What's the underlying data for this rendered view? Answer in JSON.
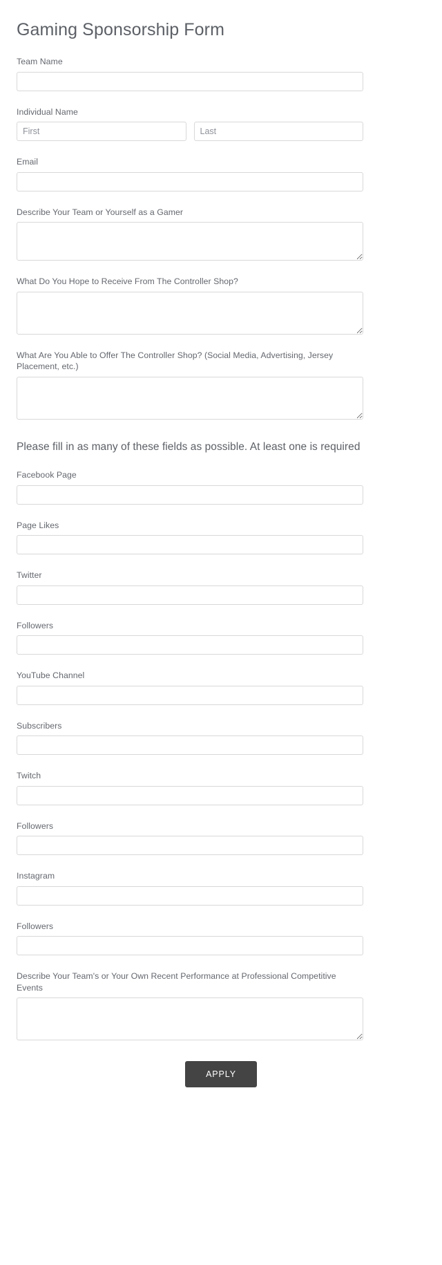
{
  "form": {
    "title": "Gaming Sponsorship Form",
    "section_heading": "Please fill in as many of these fields as possible. At least one is required",
    "submit_label": "APPLY",
    "fields": {
      "team_name": {
        "label": "Team Name",
        "value": "",
        "placeholder": ""
      },
      "individual_name": {
        "label": "Individual Name",
        "first": {
          "value": "",
          "placeholder": "First"
        },
        "last": {
          "value": "",
          "placeholder": "Last"
        }
      },
      "email": {
        "label": "Email",
        "value": "",
        "placeholder": ""
      },
      "describe_team": {
        "label": "Describe Your Team or Yourself as a Gamer",
        "value": "",
        "placeholder": ""
      },
      "hope_to_receive": {
        "label": "What Do You Hope to Receive From The Controller Shop?",
        "value": "",
        "placeholder": ""
      },
      "able_to_offer": {
        "label": "What Are You Able to Offer The Controller Shop? (Social Media, Advertising, Jersey Placement, etc.)",
        "value": "",
        "placeholder": ""
      },
      "facebook_page": {
        "label": "Facebook Page",
        "value": "",
        "placeholder": ""
      },
      "page_likes": {
        "label": "Page Likes",
        "value": "",
        "placeholder": ""
      },
      "twitter": {
        "label": "Twitter",
        "value": "",
        "placeholder": ""
      },
      "twitter_followers": {
        "label": "Followers",
        "value": "",
        "placeholder": ""
      },
      "youtube_channel": {
        "label": "YouTube Channel",
        "value": "",
        "placeholder": ""
      },
      "subscribers": {
        "label": "Subscribers",
        "value": "",
        "placeholder": ""
      },
      "twitch": {
        "label": "Twitch",
        "value": "",
        "placeholder": ""
      },
      "twitch_followers": {
        "label": "Followers",
        "value": "",
        "placeholder": ""
      },
      "instagram": {
        "label": "Instagram",
        "value": "",
        "placeholder": ""
      },
      "instagram_followers": {
        "label": "Followers",
        "value": "",
        "placeholder": ""
      },
      "recent_performance": {
        "label": "Describe Your Team's or Your Own Recent Performance at Professional Competitive Events",
        "value": "",
        "placeholder": ""
      }
    }
  },
  "colors": {
    "page_background": "#ffffff",
    "title_text": "#5c6066",
    "label_text": "#63676e",
    "input_border": "#d8d8d8",
    "button_background": "#444444",
    "button_text": "#ffffff"
  }
}
